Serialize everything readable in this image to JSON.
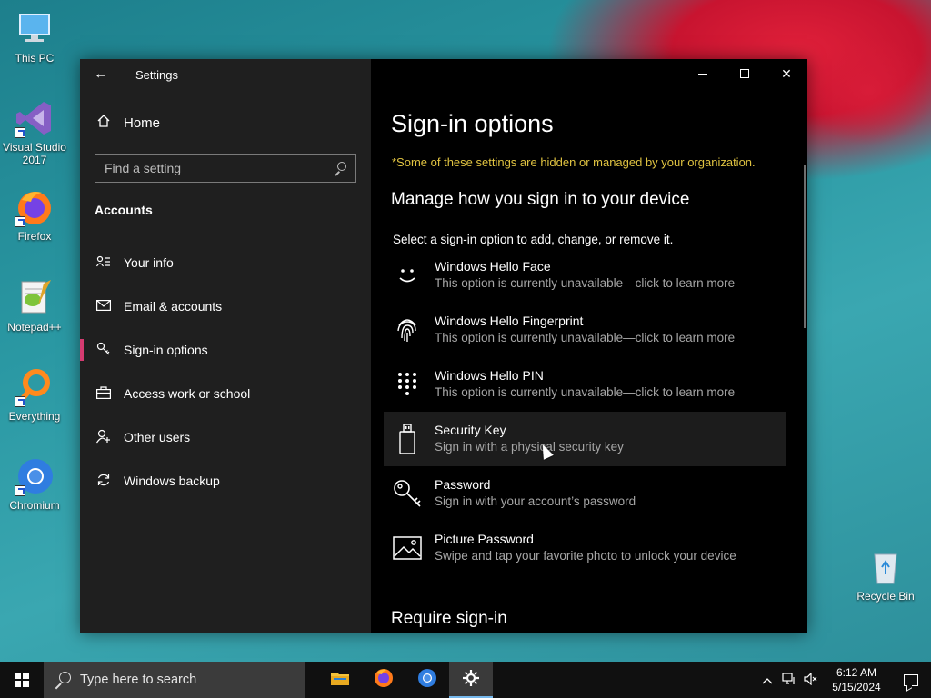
{
  "desktop": {
    "icons": [
      {
        "label": "This PC",
        "icon": "monitor-icon"
      },
      {
        "label": "Visual Studio 2017",
        "icon": "visual-studio-icon"
      },
      {
        "label": "Firefox",
        "icon": "firefox-icon"
      },
      {
        "label": "Notepad++",
        "icon": "notepadpp-icon"
      },
      {
        "label": "Everything",
        "icon": "everything-search-icon"
      },
      {
        "label": "Chromium",
        "icon": "chromium-icon"
      },
      {
        "label": "Recycle Bin",
        "icon": "recycle-bin-icon"
      }
    ]
  },
  "window": {
    "title": "Settings",
    "sidebar": {
      "home_label": "Home",
      "search_placeholder": "Find a setting",
      "section_label": "Accounts",
      "items": [
        {
          "label": "Your info",
          "icon": "person-card-icon"
        },
        {
          "label": "Email & accounts",
          "icon": "envelope-icon"
        },
        {
          "label": "Sign-in options",
          "icon": "key-icon",
          "active": true
        },
        {
          "label": "Access work or school",
          "icon": "briefcase-icon"
        },
        {
          "label": "Other users",
          "icon": "add-person-icon"
        },
        {
          "label": "Windows backup",
          "icon": "sync-icon"
        }
      ]
    },
    "main": {
      "title": "Sign-in options",
      "notice": "*Some of these settings are hidden or managed by your organization.",
      "subtitle": "Manage how you sign in to your device",
      "hint": "Select a sign-in option to add, change, or remove it.",
      "options": [
        {
          "name": "Windows Hello Face",
          "desc": "This option is currently unavailable—click to learn more",
          "icon": "face-icon"
        },
        {
          "name": "Windows Hello Fingerprint",
          "desc": "This option is currently unavailable—click to learn more",
          "icon": "fingerprint-icon"
        },
        {
          "name": "Windows Hello PIN",
          "desc": "This option is currently unavailable—click to learn more",
          "icon": "pin-keypad-icon"
        },
        {
          "name": "Security Key",
          "desc": "Sign in with a physical security key",
          "icon": "usb-key-icon"
        },
        {
          "name": "Password",
          "desc": "Sign in with your account’s password",
          "icon": "password-key-icon"
        },
        {
          "name": "Picture Password",
          "desc": "Swipe and tap your favorite photo to unlock your device",
          "icon": "picture-icon"
        }
      ],
      "require_title": "Require sign-in"
    }
  },
  "taskbar": {
    "search_placeholder": "Type here to search",
    "apps": [
      "file-explorer-icon",
      "firefox-icon",
      "chromium-icon",
      "settings-gear-icon"
    ],
    "time": "6:12 AM",
    "date": "5/15/2024"
  }
}
